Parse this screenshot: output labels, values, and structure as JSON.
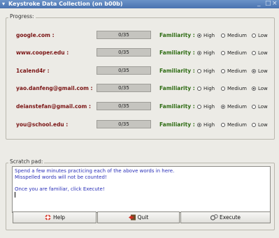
{
  "window": {
    "menu_glyph": "▾",
    "title": "Keystroke Data Collection (on b00b)",
    "minimize": "_",
    "maximize": "□",
    "close": "×"
  },
  "progress_frame": {
    "label": "Progress:"
  },
  "familiarity_label": "Familiarity :",
  "options": [
    "High",
    "Medium",
    "Low"
  ],
  "rows": [
    {
      "site": "google.com :",
      "progress": "0/35",
      "selected": "High"
    },
    {
      "site": "www.cooper.edu :",
      "progress": "0/35",
      "selected": "High"
    },
    {
      "site": "1calend4r :",
      "progress": "0/35",
      "selected": "Low"
    },
    {
      "site": "yao.danfeng@gmail.com :",
      "progress": "0/35",
      "selected": "Low"
    },
    {
      "site": "deianstefan@gmail.com :",
      "progress": "0/35",
      "selected": "Medium"
    },
    {
      "site": "you@school.edu :",
      "progress": "0/35",
      "selected": "High"
    }
  ],
  "scratch_frame": {
    "label": "Scratch pad:"
  },
  "scratch_lines": [
    "Spend a few minutes practicing each of the above words in here.",
    "Misspelled words will not be counted!",
    "",
    "Once you are familiar, click Execute!"
  ],
  "buttons": {
    "help": "Help",
    "quit": "Quit",
    "execute": "Execute"
  },
  "colors": {
    "site_label": "#7a1414",
    "familiarity_label": "#2d6b12",
    "scratch_text": "#2a30b8",
    "titlebar": "#4a73b0"
  }
}
